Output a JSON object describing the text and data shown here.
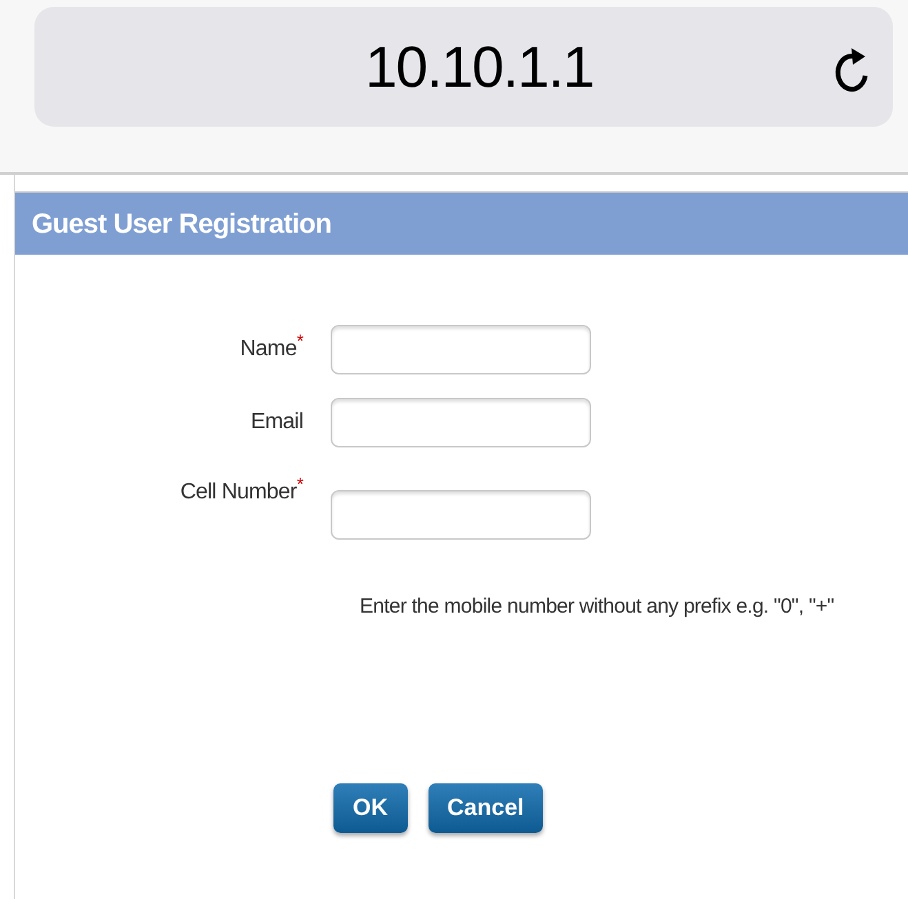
{
  "address_bar": {
    "url": "10.10.1.1"
  },
  "form": {
    "title": "Guest User Registration",
    "fields": [
      {
        "label": "Name$^{*}$"
      },
      {
        "label": "Email"
      },
      {
        "label": "Cell Number$^{*}$"
      }
    ],
    "hint": "Enter the mobile number without any prefix e.g. \"0\", \"+\"",
    "buttons": [
      "OK",
      "Cancel"
    ]
  }
}
